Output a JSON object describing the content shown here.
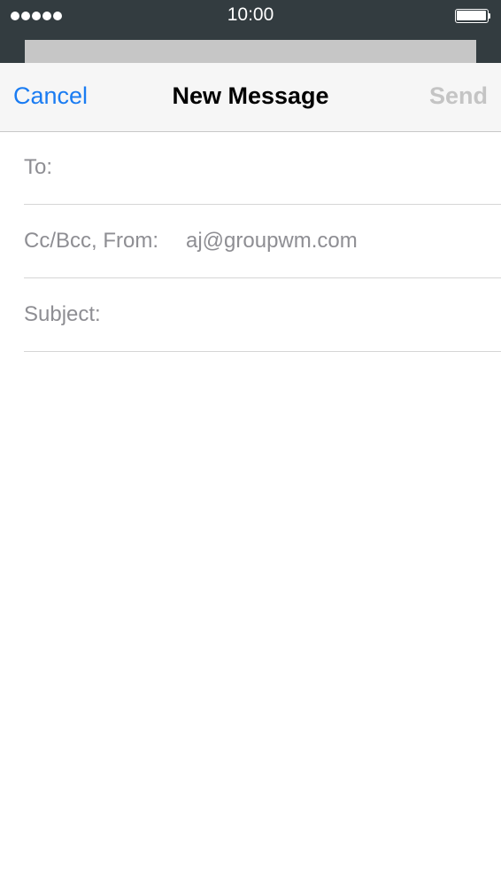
{
  "status_bar": {
    "time": "10:00",
    "signal_icon": "signal-dots-icon",
    "battery_icon": "battery-full-icon",
    "background_color": "#333c40"
  },
  "nav": {
    "cancel_label": "Cancel",
    "title": "New Message",
    "send_label": "Send",
    "accent_color": "#1a7cf2",
    "disabled_color": "#c4c4c4"
  },
  "fields": {
    "to": {
      "label": "To:",
      "value": ""
    },
    "cc_from": {
      "label": "Cc/Bcc, From:",
      "value": "aj@groupwm.com"
    },
    "subject": {
      "label": "Subject:",
      "value": ""
    }
  },
  "body": {
    "value": ""
  }
}
